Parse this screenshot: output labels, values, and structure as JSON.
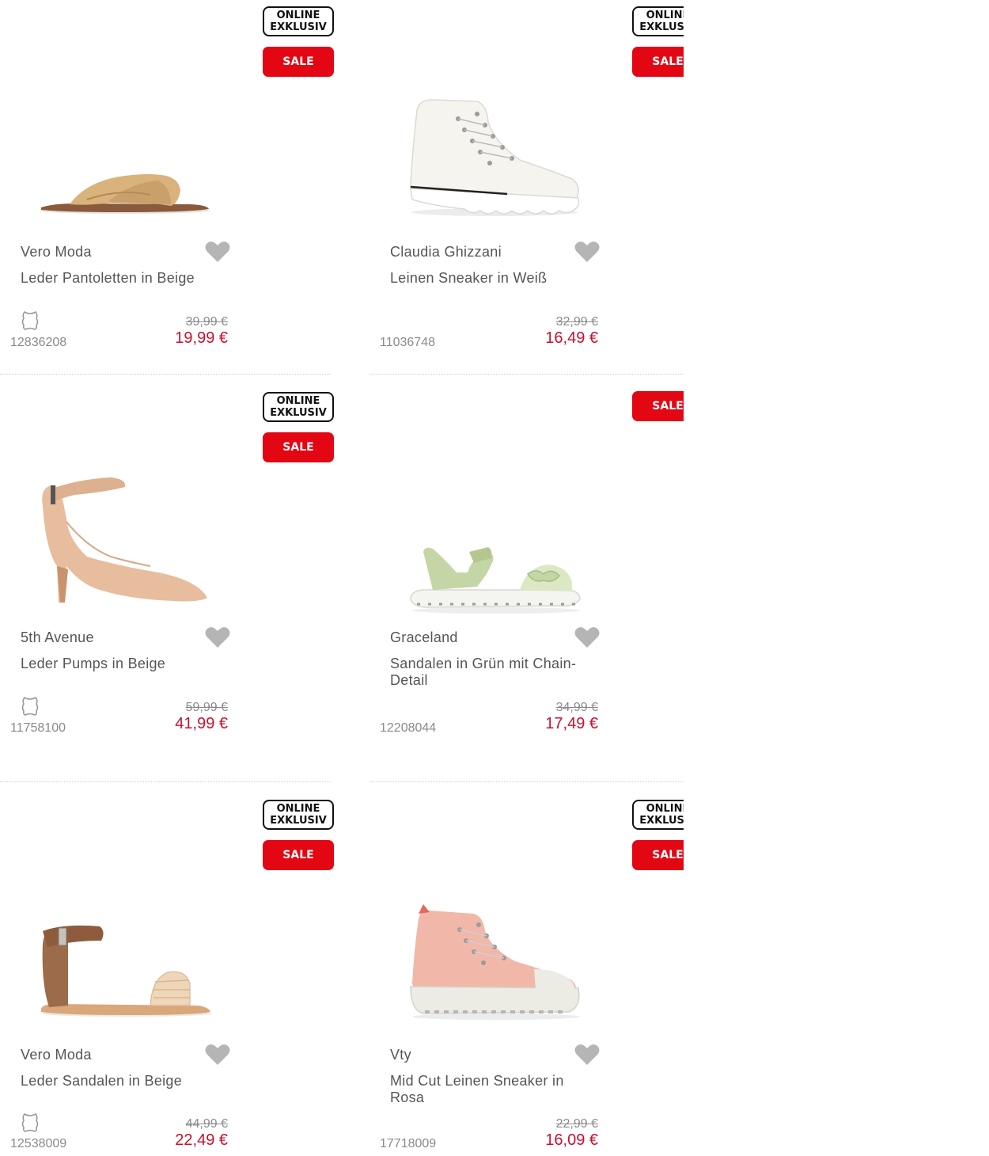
{
  "badges": {
    "online": "ONLINE\nEXKLUSIV",
    "sale": "SALE"
  },
  "colors": {
    "sale_red": "#e30613",
    "price_red": "#c8102e",
    "heart_gray": "#b5b5b5"
  },
  "products": [
    {
      "brand": "Vero Moda",
      "title": "Leder Pantoletten in Beige",
      "sku": "12836208",
      "old_price": "39,99 €",
      "new_price": "19,99 €",
      "online_exclusive": true,
      "leather": true,
      "icon": "heart-icon"
    },
    {
      "brand": "Claudia Ghizzani",
      "title": "Leinen Sneaker in Weiß",
      "sku": "11036748",
      "old_price": "32,99 €",
      "new_price": "16,49 €",
      "online_exclusive": true,
      "leather": false,
      "icon": "heart-icon"
    },
    {
      "brand": "5th Avenue",
      "title": "Leder Pumps in Beige",
      "sku": "11758100",
      "old_price": "59,99 €",
      "new_price": "41,99 €",
      "online_exclusive": true,
      "leather": true,
      "icon": "heart-icon"
    },
    {
      "brand": "Graceland",
      "title": "Sandalen in Grün mit Chain-Detail",
      "sku": "12208044",
      "old_price": "34,99 €",
      "new_price": "17,49 €",
      "online_exclusive": false,
      "leather": false,
      "icon": "heart-icon"
    },
    {
      "brand": "Vero Moda",
      "title": "Leder Sandalen in Beige",
      "sku": "12538009",
      "old_price": "44,99 €",
      "new_price": "22,49 €",
      "online_exclusive": true,
      "leather": true,
      "icon": "heart-icon"
    },
    {
      "brand": "Vty",
      "title": "Mid Cut Leinen Sneaker in Rosa",
      "sku": "17718009",
      "old_price": "22,99 €",
      "new_price": "16,09 €",
      "online_exclusive": true,
      "leather": false,
      "icon": "heart-icon"
    }
  ]
}
